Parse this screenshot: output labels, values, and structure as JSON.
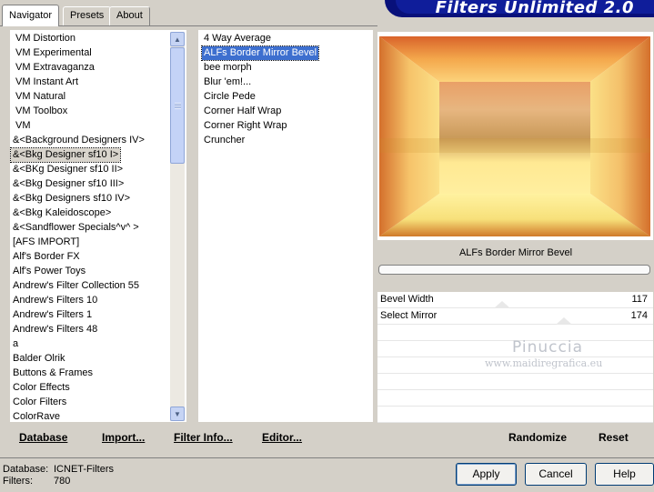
{
  "tabs": [
    {
      "label": "Navigator",
      "active": true
    },
    {
      "label": "Presets",
      "active": false
    },
    {
      "label": "About",
      "active": false
    }
  ],
  "banner": {
    "title": "Filters Unlimited 2.0"
  },
  "categories": [
    "VM Distortion",
    "VM Experimental",
    "VM Extravaganza",
    "VM Instant Art",
    "VM Natural",
    "VM Toolbox",
    "VM",
    "&<Background Designers IV>",
    "&<Bkg Designer sf10 I>",
    "&<BKg Designer sf10 II>",
    "&<Bkg Designer sf10 III>",
    "&<Bkg Designers sf10 IV>",
    "&<Bkg Kaleidoscope>",
    "&<Sandflower Specials^v^ >",
    "[AFS IMPORT]",
    "Alf's Border FX",
    "Alf's Power Toys",
    "Andrew's Filter Collection 55",
    "Andrew's Filters 10",
    "Andrew's Filters 1",
    "Andrew's Filters 48",
    "a",
    "Balder Olrik",
    "Buttons & Frames",
    "Color Effects",
    "Color Filters",
    "ColorRave"
  ],
  "selected_category": "&<Bkg Designer sf10 I>",
  "filters": [
    "4 Way Average",
    "ALFs Border Mirror Bevel",
    "bee morph",
    "Blur 'em!...",
    "Circle Pede",
    "Corner Half Wrap",
    "Corner Right Wrap",
    "Cruncher"
  ],
  "selected_filter": "ALFs Border Mirror Bevel",
  "current_filter_name": "ALFs Border Mirror Bevel",
  "settings": [
    {
      "label": "Bevel Width",
      "value": "117"
    },
    {
      "label": "Select Mirror",
      "value": "174"
    }
  ],
  "watermark": {
    "name": "Pinuccia",
    "site": "www.maidiregrafica.eu"
  },
  "toolbar": {
    "database": "Database",
    "import": "Import...",
    "filter_info": "Filter Info...",
    "editor": "Editor...",
    "randomize": "Randomize",
    "reset": "Reset"
  },
  "status": {
    "database_label": "Database:",
    "database_value": "ICNET-Filters",
    "filters_label": "Filters:",
    "filters_value": "780"
  },
  "buttons": {
    "apply": "Apply",
    "cancel": "Cancel",
    "help": "Help"
  },
  "colors": {
    "selection_blue": "#3d6fcf",
    "banner_navy": "#08107a",
    "window_bg": "#d4d0c8"
  }
}
